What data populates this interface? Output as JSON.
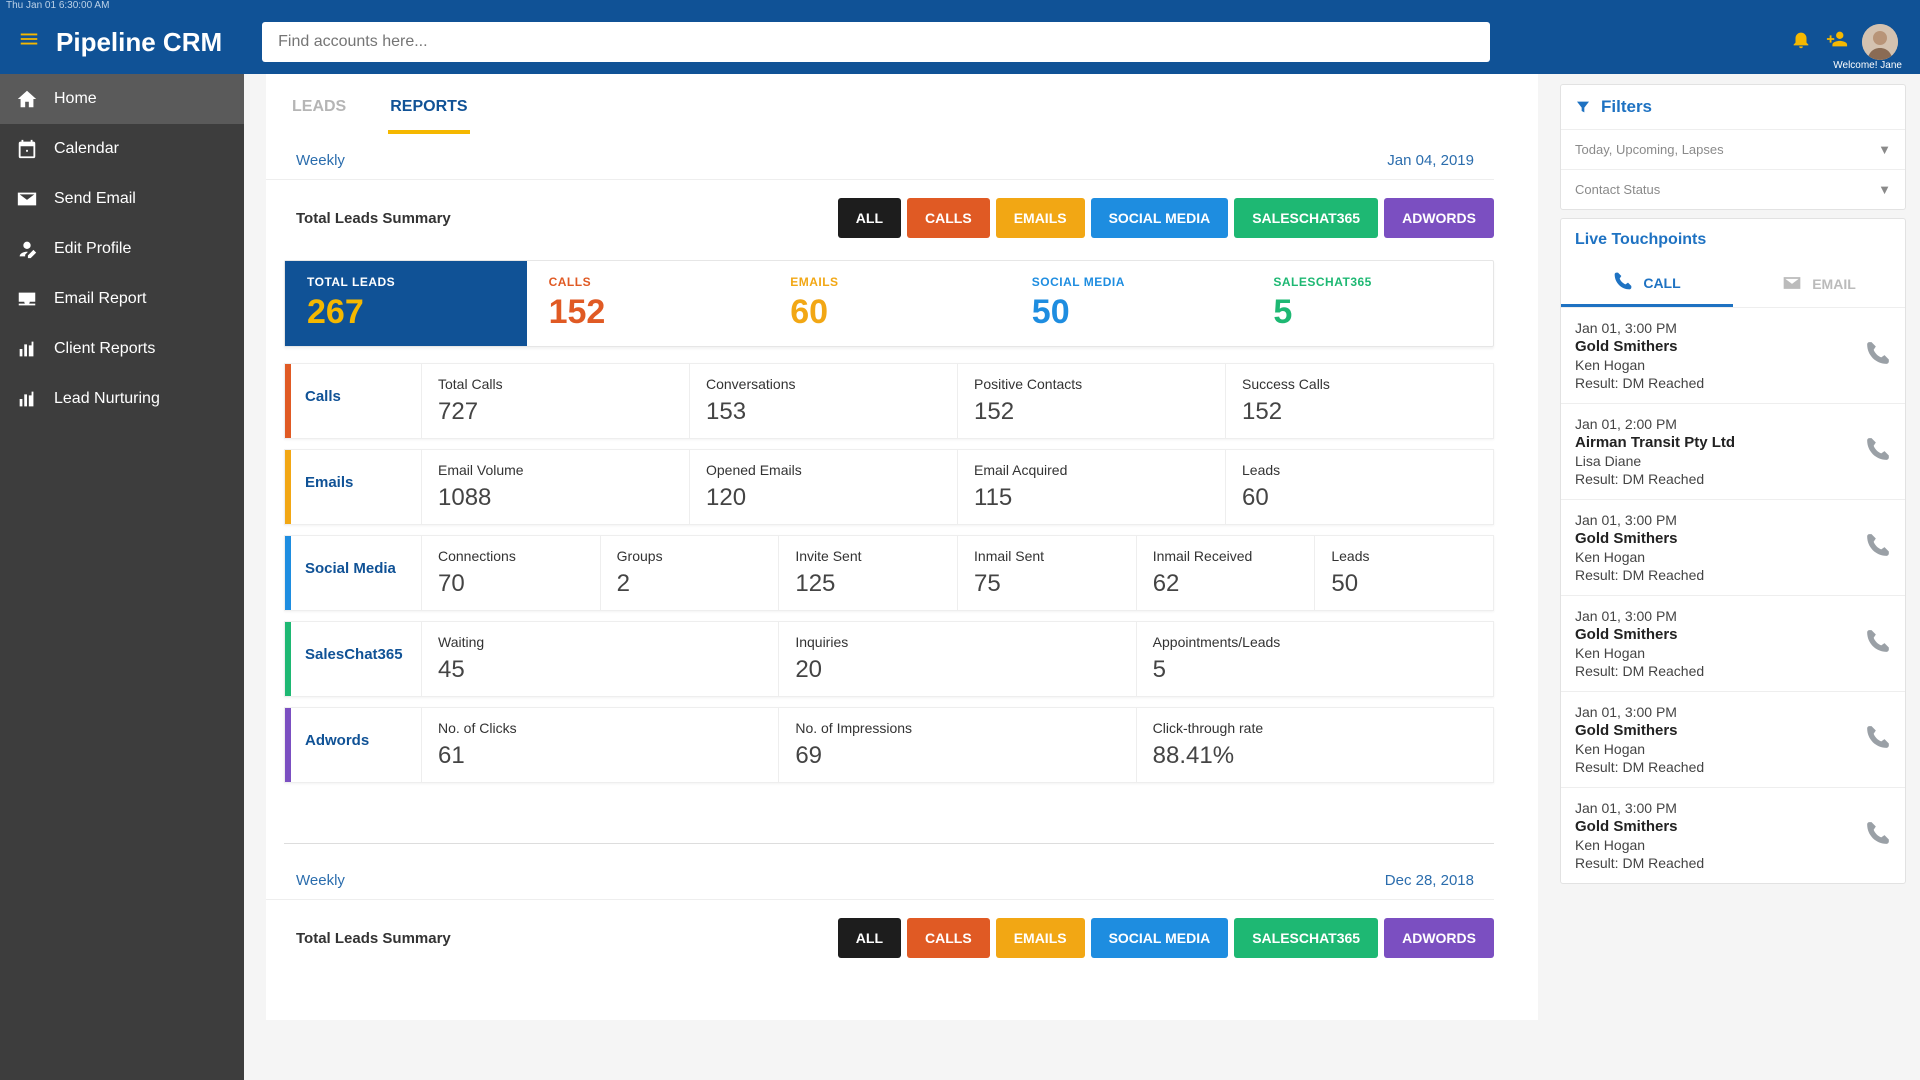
{
  "topbar_time": "Thu Jan 01 6:30:00 AM",
  "brand": "Pipeline CRM",
  "search_placeholder": "Find accounts here...",
  "welcome": "Welcome! Jane",
  "sidebar": [
    {
      "icon": "home",
      "label": "Home",
      "active": true
    },
    {
      "icon": "calendar",
      "label": "Calendar"
    },
    {
      "icon": "mail",
      "label": "Send Email"
    },
    {
      "icon": "person-edit",
      "label": "Edit Profile"
    },
    {
      "icon": "inbox",
      "label": "Email Report"
    },
    {
      "icon": "chart",
      "label": "Client Reports"
    },
    {
      "icon": "chart",
      "label": "Lead Nurturing"
    }
  ],
  "tabs": [
    {
      "label": "LEADS",
      "active": false
    },
    {
      "label": "REPORTS",
      "active": true
    }
  ],
  "reports": [
    {
      "period": "Weekly",
      "date": "Jan 04, 2019",
      "summary_title": "Total Leads Summary",
      "chips": [
        "ALL",
        "CALLS",
        "EMAILS",
        "SOCIAL MEDIA",
        "SALESCHAT365",
        "ADWORDS"
      ],
      "metrics": [
        {
          "label": "TOTAL LEADS",
          "value": "267"
        },
        {
          "label": "CALLS",
          "value": "152"
        },
        {
          "label": "EMAILS",
          "value": "60"
        },
        {
          "label": "SOCIAL MEDIA",
          "value": "50"
        },
        {
          "label": "SALESCHAT365",
          "value": "5"
        }
      ],
      "cards": [
        {
          "cat": "Calls",
          "edge": "calls",
          "cells": [
            {
              "l": "Total Calls",
              "v": "727"
            },
            {
              "l": "Conversations",
              "v": "153"
            },
            {
              "l": "Positive Contacts",
              "v": "152"
            },
            {
              "l": "Success Calls",
              "v": "152"
            }
          ]
        },
        {
          "cat": "Emails",
          "edge": "emails",
          "cells": [
            {
              "l": "Email Volume",
              "v": "1088"
            },
            {
              "l": "Opened Emails",
              "v": "120"
            },
            {
              "l": "Email Acquired",
              "v": "115"
            },
            {
              "l": "Leads",
              "v": "60"
            }
          ]
        },
        {
          "cat": "Social Media",
          "edge": "social",
          "cells": [
            {
              "l": "Connections",
              "v": "70"
            },
            {
              "l": "Groups",
              "v": "2"
            },
            {
              "l": "Invite Sent",
              "v": "125"
            },
            {
              "l": "Inmail Sent",
              "v": "75"
            },
            {
              "l": "Inmail Received",
              "v": "62"
            },
            {
              "l": "Leads",
              "v": "50"
            }
          ]
        },
        {
          "cat": "SalesChat365",
          "edge": "sales",
          "cells": [
            {
              "l": "Waiting",
              "v": "45"
            },
            {
              "l": "Inquiries",
              "v": "20"
            },
            {
              "l": "Appointments/Leads",
              "v": "5"
            }
          ]
        },
        {
          "cat": "Adwords",
          "edge": "adw",
          "cells": [
            {
              "l": "No. of Clicks",
              "v": "61"
            },
            {
              "l": "No. of Impressions",
              "v": "69"
            },
            {
              "l": "Click-through rate",
              "v": "88.41%"
            }
          ]
        }
      ]
    },
    {
      "period": "Weekly",
      "date": "Dec 28, 2018",
      "summary_title": "Total Leads Summary",
      "chips": [
        "ALL",
        "CALLS",
        "EMAILS",
        "SOCIAL MEDIA",
        "SALESCHAT365",
        "ADWORDS"
      ]
    }
  ],
  "filters": {
    "title": "Filters",
    "row1": "Today, Upcoming, Lapses",
    "row2": "Contact Status"
  },
  "touchpoints": {
    "title": "Live Touchpoints",
    "tabs": [
      {
        "label": "CALL",
        "active": true
      },
      {
        "label": "EMAIL",
        "active": false
      }
    ],
    "items": [
      {
        "dt": "Jan 01, 3:00 PM",
        "co": "Gold Smithers",
        "pe": "Ken Hogan",
        "re": "Result: DM Reached"
      },
      {
        "dt": "Jan 01, 2:00 PM",
        "co": "Airman Transit Pty Ltd",
        "pe": "Lisa Diane",
        "re": "Result: DM Reached"
      },
      {
        "dt": "Jan 01, 3:00 PM",
        "co": "Gold Smithers",
        "pe": "Ken Hogan",
        "re": "Result: DM Reached"
      },
      {
        "dt": "Jan 01, 3:00 PM",
        "co": "Gold Smithers",
        "pe": "Ken Hogan",
        "re": "Result: DM Reached"
      },
      {
        "dt": "Jan 01, 3:00 PM",
        "co": "Gold Smithers",
        "pe": "Ken Hogan",
        "re": "Result: DM Reached"
      },
      {
        "dt": "Jan 01, 3:00 PM",
        "co": "Gold Smithers",
        "pe": "Ken Hogan",
        "re": "Result: DM Reached"
      }
    ]
  }
}
